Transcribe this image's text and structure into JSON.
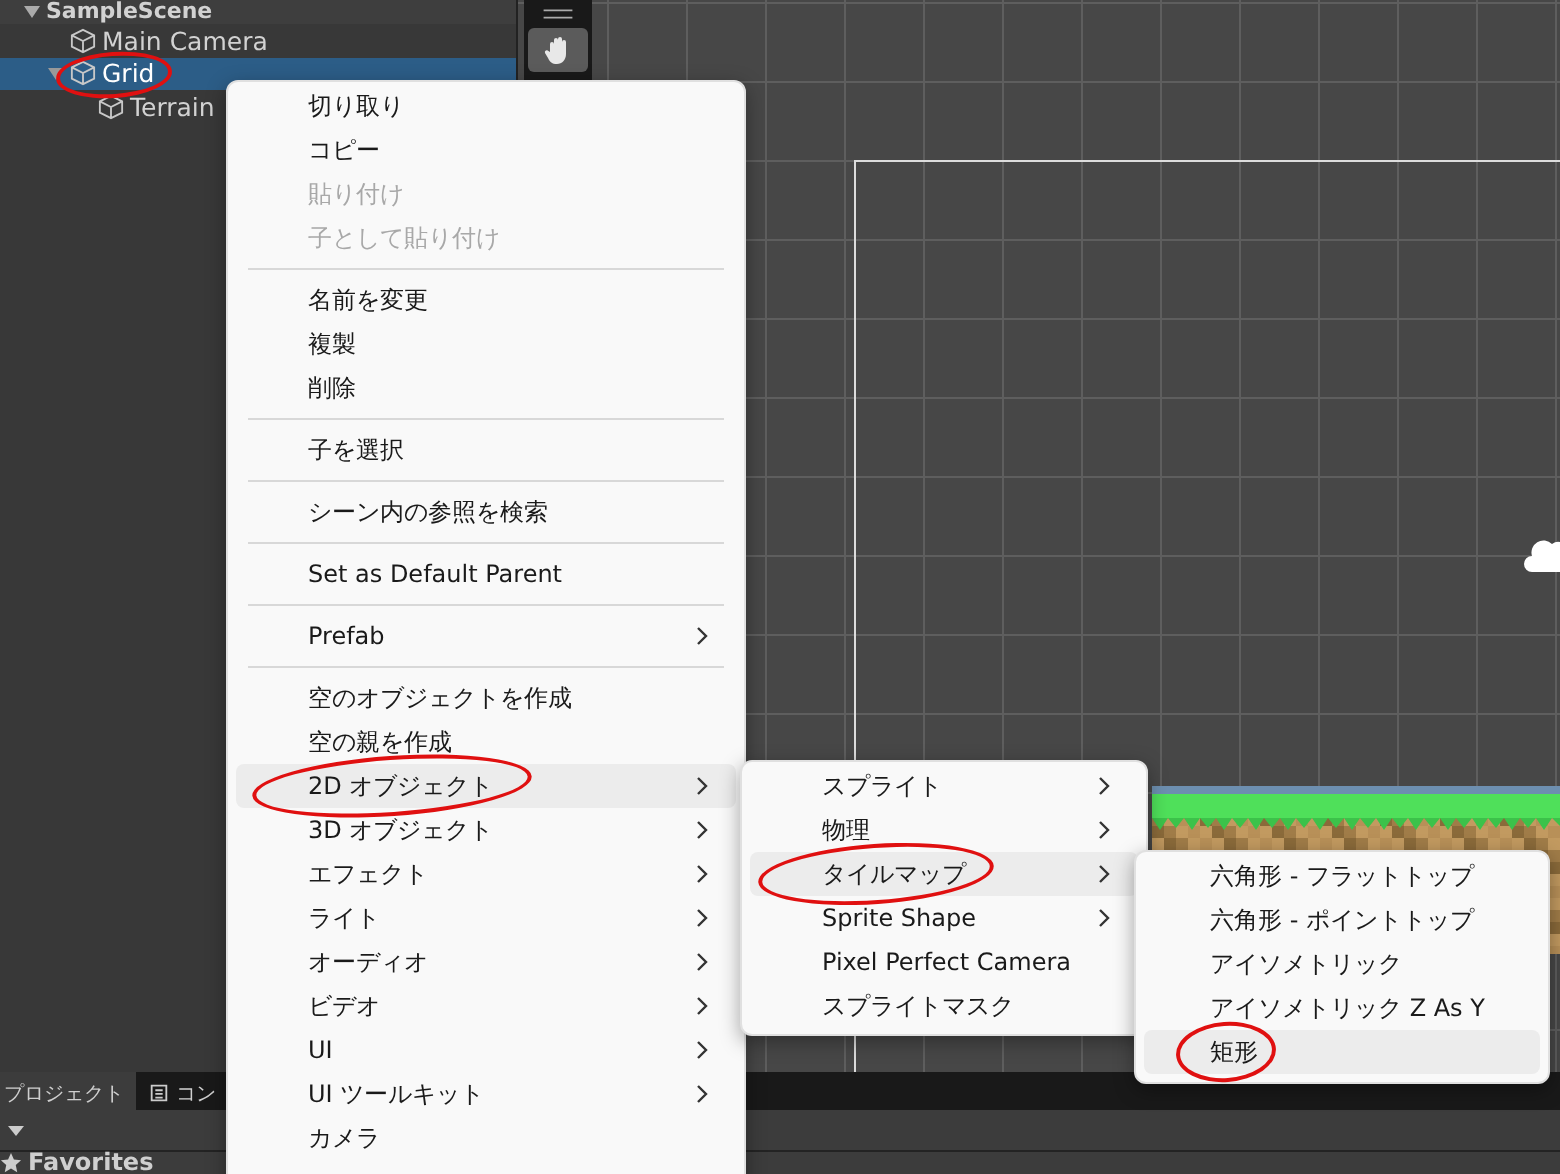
{
  "hierarchy": {
    "scene": "SampleScene",
    "items": [
      {
        "label": "Main Camera",
        "selected": false,
        "circled": false
      },
      {
        "label": "Grid",
        "selected": true,
        "circled": true,
        "expanded": true,
        "children": [
          {
            "label": "Terrain",
            "selected": false,
            "circled": false
          }
        ]
      }
    ]
  },
  "bottom_panel": {
    "tabs": [
      {
        "label": "プロジェクト",
        "selected": true
      },
      {
        "label": "コン",
        "selected": false
      }
    ],
    "favorites": "Favorites"
  },
  "context_menu": {
    "groups": [
      [
        {
          "label": "切り取り",
          "disabled": false,
          "submenu": false,
          "highlighted": false,
          "circled": false
        },
        {
          "label": "コピー",
          "disabled": false,
          "submenu": false,
          "highlighted": false,
          "circled": false
        },
        {
          "label": "貼り付け",
          "disabled": true,
          "submenu": false,
          "highlighted": false,
          "circled": false
        },
        {
          "label": "子として貼り付け",
          "disabled": true,
          "submenu": false,
          "highlighted": false,
          "circled": false
        }
      ],
      [
        {
          "label": "名前を変更",
          "disabled": false,
          "submenu": false,
          "highlighted": false,
          "circled": false
        },
        {
          "label": "複製",
          "disabled": false,
          "submenu": false,
          "highlighted": false,
          "circled": false
        },
        {
          "label": "削除",
          "disabled": false,
          "submenu": false,
          "highlighted": false,
          "circled": false
        }
      ],
      [
        {
          "label": "子を選択",
          "disabled": false,
          "submenu": false,
          "highlighted": false,
          "circled": false
        }
      ],
      [
        {
          "label": "シーン内の参照を検索",
          "disabled": false,
          "submenu": false,
          "highlighted": false,
          "circled": false
        }
      ],
      [
        {
          "label": "Set as Default Parent",
          "disabled": false,
          "submenu": false,
          "highlighted": false,
          "circled": false
        }
      ],
      [
        {
          "label": "Prefab",
          "disabled": false,
          "submenu": true,
          "highlighted": false,
          "circled": false
        }
      ],
      [
        {
          "label": "空のオブジェクトを作成",
          "disabled": false,
          "submenu": false,
          "highlighted": false,
          "circled": false
        },
        {
          "label": "空の親を作成",
          "disabled": false,
          "submenu": false,
          "highlighted": false,
          "circled": false
        },
        {
          "label": "2D オブジェクト",
          "disabled": false,
          "submenu": true,
          "highlighted": true,
          "circled": true
        },
        {
          "label": "3D オブジェクト",
          "disabled": false,
          "submenu": true,
          "highlighted": false,
          "circled": false
        },
        {
          "label": "エフェクト",
          "disabled": false,
          "submenu": true,
          "highlighted": false,
          "circled": false
        },
        {
          "label": "ライト",
          "disabled": false,
          "submenu": true,
          "highlighted": false,
          "circled": false
        },
        {
          "label": "オーディオ",
          "disabled": false,
          "submenu": true,
          "highlighted": false,
          "circled": false
        },
        {
          "label": "ビデオ",
          "disabled": false,
          "submenu": true,
          "highlighted": false,
          "circled": false
        },
        {
          "label": "UI",
          "disabled": false,
          "submenu": true,
          "highlighted": false,
          "circled": false
        },
        {
          "label": "UI ツールキット",
          "disabled": false,
          "submenu": true,
          "highlighted": false,
          "circled": false
        },
        {
          "label": "カメラ",
          "disabled": false,
          "submenu": false,
          "highlighted": false,
          "circled": false
        }
      ]
    ]
  },
  "submenu_2d": [
    {
      "label": "スプライト",
      "submenu": true,
      "highlighted": false,
      "circled": false
    },
    {
      "label": "物理",
      "submenu": true,
      "highlighted": false,
      "circled": false
    },
    {
      "label": "タイルマップ",
      "submenu": true,
      "highlighted": true,
      "circled": true
    },
    {
      "label": "Sprite Shape",
      "submenu": true,
      "highlighted": false,
      "circled": false
    },
    {
      "label": "Pixel Perfect Camera",
      "submenu": false,
      "highlighted": false,
      "circled": false
    },
    {
      "label": "スプライトマスク",
      "submenu": false,
      "highlighted": false,
      "circled": false
    }
  ],
  "submenu_tilemap": [
    {
      "label": "六角形 - フラットトップ",
      "highlighted": false,
      "circled": false
    },
    {
      "label": "六角形 - ポイントトップ",
      "highlighted": false,
      "circled": false
    },
    {
      "label": "アイソメトリック",
      "highlighted": false,
      "circled": false
    },
    {
      "label": "アイソメトリック Z As Y",
      "highlighted": false,
      "circled": false
    },
    {
      "label": "矩形",
      "highlighted": true,
      "circled": true
    }
  ]
}
